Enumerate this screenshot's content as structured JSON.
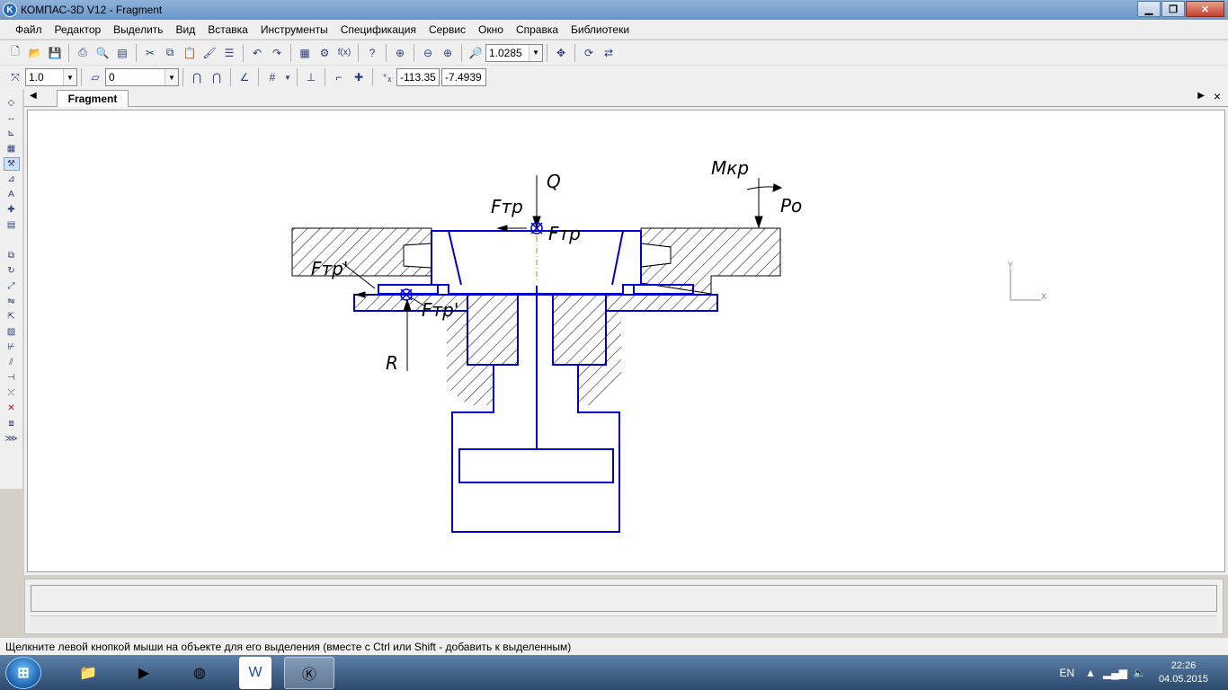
{
  "window": {
    "title": "КОМПАС-3D V12 - Fragment",
    "app_icon": "K",
    "minimize": "▁",
    "maximize": "❐",
    "close": "✕"
  },
  "menu": [
    "Файл",
    "Редактор",
    "Выделить",
    "Вид",
    "Вставка",
    "Инструменты",
    "Спецификация",
    "Сервис",
    "Окно",
    "Справка",
    "Библиотеки"
  ],
  "toolbar": {
    "zoom_value": "1.0285",
    "fx_label": "f(x)"
  },
  "toolbar2": {
    "line_scale": "1.0",
    "layer": "0",
    "coord_x": "-113.35",
    "coord_y": "-7.4939"
  },
  "document": {
    "tab_label": "Fragment"
  },
  "drawing": {
    "labels": {
      "q": "Q",
      "mkp": "Мкр",
      "po": "Ро",
      "ftr_left": "Fтр",
      "ftr_right": "Fтр",
      "ftr1_left": "Fтр'",
      "ftr1_right": "Fтр'",
      "r": "R"
    },
    "axes": {
      "x": "X",
      "y": "Y"
    },
    "line_color": "#0000cc"
  },
  "status": {
    "text": "Щелкните левой кнопкой мыши на объекте для его выделения (вместе с Ctrl или Shift - добавить к выделенным)"
  },
  "taskbar": {
    "lang": "EN",
    "time": "22:26",
    "date": "04.05.2015"
  }
}
